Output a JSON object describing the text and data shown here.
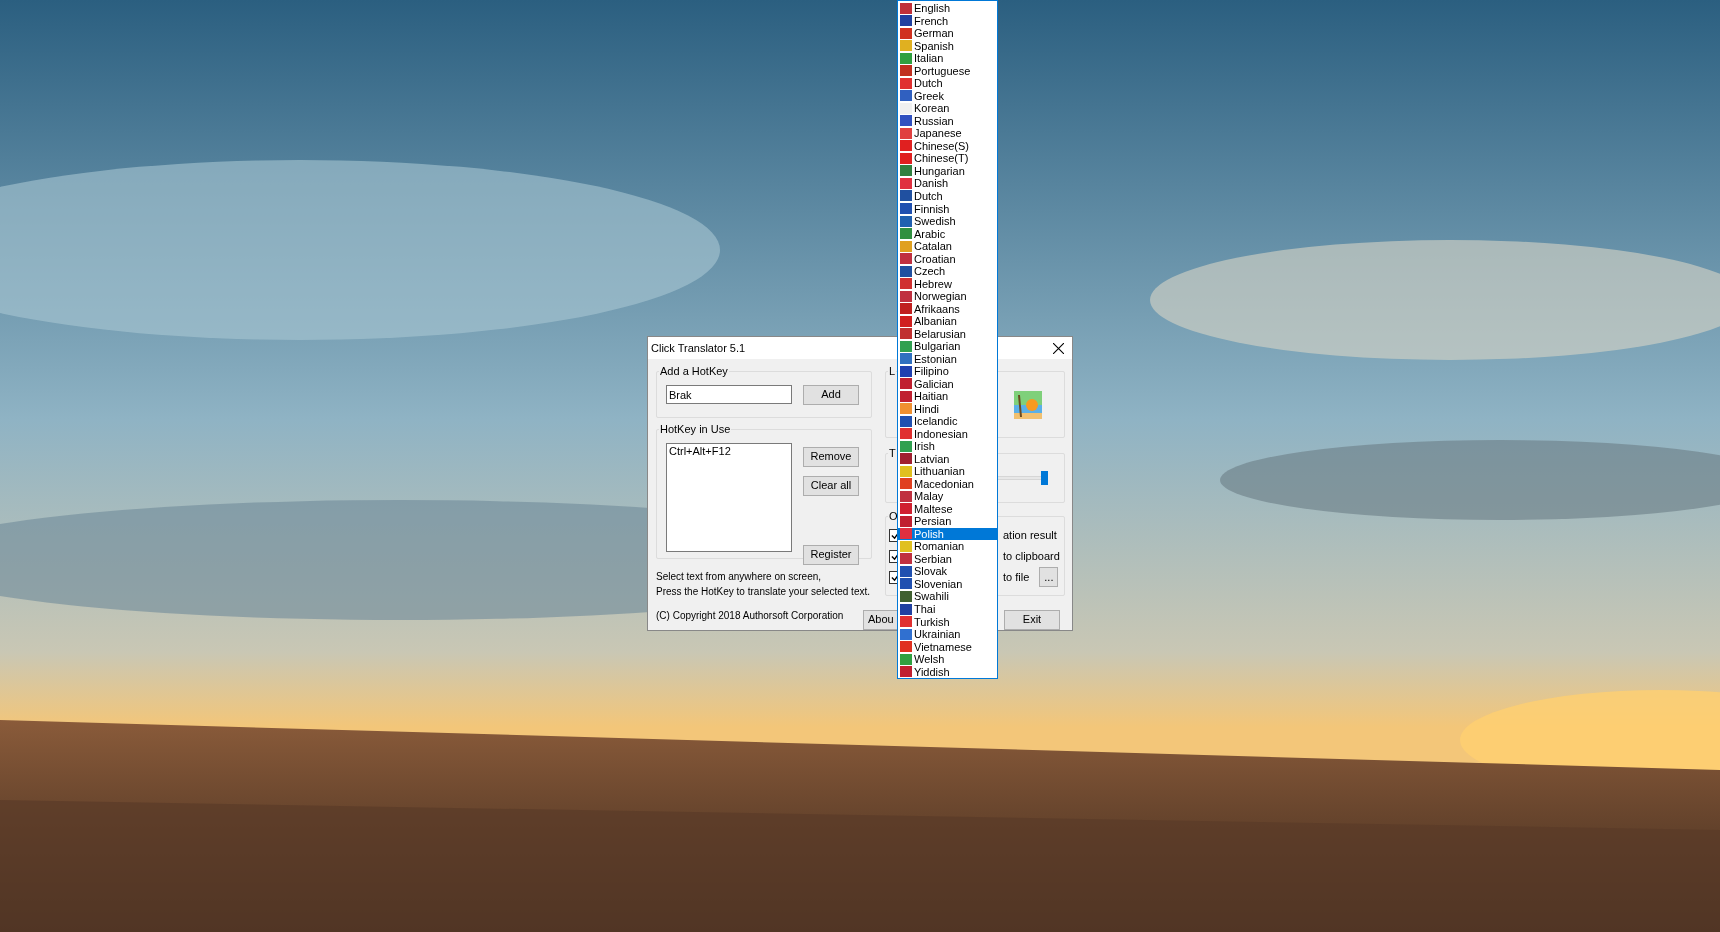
{
  "dialog": {
    "title": "Click Translator 5.1",
    "add_group": {
      "title": "Add a HotKey",
      "value": "Brak",
      "button": "Add"
    },
    "in_use_group": {
      "title": "HotKey in Use",
      "items": [
        "Ctrl+Alt+F12"
      ],
      "buttons": [
        "Remove",
        "Clear all",
        "Register"
      ]
    },
    "hint_lines": [
      "Select text from anywhere on screen,",
      "Press the HotKey to translate your selected text."
    ],
    "copyright": "(C) Copyright 2018 Authorsoft Corporation",
    "language_group": {
      "title": "L"
    },
    "slider_group": {
      "title": "T",
      "level": 1.0
    },
    "options_group": {
      "title": "O",
      "options": [
        {
          "label": "ation result",
          "checked": true
        },
        {
          "label": "to clipboard",
          "checked": true
        },
        {
          "label": "to file",
          "checked": true,
          "button": "..."
        }
      ]
    },
    "about_button": "Abou",
    "exit_button": "Exit"
  },
  "language_list": [
    {
      "label": "English",
      "color": "#c0303a",
      "selected": false
    },
    {
      "label": "French",
      "color": "#2040a0",
      "selected": false
    },
    {
      "label": "German",
      "color": "#d03020",
      "selected": false
    },
    {
      "label": "Spanish",
      "color": "#e0b020",
      "selected": false
    },
    {
      "label": "Italian",
      "color": "#30a040",
      "selected": false
    },
    {
      "label": "Portuguese",
      "color": "#c03020",
      "selected": false
    },
    {
      "label": "Dutch",
      "color": "#e03030",
      "selected": false
    },
    {
      "label": "Greek",
      "color": "#3060c0",
      "selected": false
    },
    {
      "label": "Korean",
      "color": "#f0f0f0",
      "selected": false
    },
    {
      "label": "Russian",
      "color": "#3050c0",
      "selected": false
    },
    {
      "label": "Japanese",
      "color": "#e04040",
      "selected": false
    },
    {
      "label": "Chinese(S)",
      "color": "#e02020",
      "selected": false
    },
    {
      "label": "Chinese(T)",
      "color": "#e02020",
      "selected": false
    },
    {
      "label": "Hungarian",
      "color": "#308040",
      "selected": false
    },
    {
      "label": "Danish",
      "color": "#e03040",
      "selected": false
    },
    {
      "label": "Dutch",
      "color": "#2050a0",
      "selected": false
    },
    {
      "label": "Finnish",
      "color": "#2050b0",
      "selected": false
    },
    {
      "label": "Swedish",
      "color": "#2060b0",
      "selected": false
    },
    {
      "label": "Arabic",
      "color": "#309040",
      "selected": false
    },
    {
      "label": "Catalan",
      "color": "#e0a020",
      "selected": false
    },
    {
      "label": "Croatian",
      "color": "#c03040",
      "selected": false
    },
    {
      "label": "Czech",
      "color": "#2050a0",
      "selected": false
    },
    {
      "label": "Hebrew",
      "color": "#d03030",
      "selected": false
    },
    {
      "label": "Norwegian",
      "color": "#c03040",
      "selected": false
    },
    {
      "label": "Afrikaans",
      "color": "#c02020",
      "selected": false
    },
    {
      "label": "Albanian",
      "color": "#d02020",
      "selected": false
    },
    {
      "label": "Belarusian",
      "color": "#c03030",
      "selected": false
    },
    {
      "label": "Bulgarian",
      "color": "#30a050",
      "selected": false
    },
    {
      "label": "Estonian",
      "color": "#3070c0",
      "selected": false
    },
    {
      "label": "Filipino",
      "color": "#2040b0",
      "selected": false
    },
    {
      "label": "Galician",
      "color": "#c02030",
      "selected": false
    },
    {
      "label": "Haitian",
      "color": "#c02030",
      "selected": false
    },
    {
      "label": "Hindi",
      "color": "#f09030",
      "selected": false
    },
    {
      "label": "Icelandic",
      "color": "#2050b0",
      "selected": false
    },
    {
      "label": "Indonesian",
      "color": "#e03030",
      "selected": false
    },
    {
      "label": "Irish",
      "color": "#30a050",
      "selected": false
    },
    {
      "label": "Latvian",
      "color": "#a02030",
      "selected": false
    },
    {
      "label": "Lithuanian",
      "color": "#e0c020",
      "selected": false
    },
    {
      "label": "Macedonian",
      "color": "#e04020",
      "selected": false
    },
    {
      "label": "Malay",
      "color": "#c03040",
      "selected": false
    },
    {
      "label": "Maltese",
      "color": "#d02030",
      "selected": false
    },
    {
      "label": "Persian",
      "color": "#c02030",
      "selected": false
    },
    {
      "label": "Polish",
      "color": "#e03040",
      "selected": true
    },
    {
      "label": "Romanian",
      "color": "#e0c020",
      "selected": false
    },
    {
      "label": "Serbian",
      "color": "#c03040",
      "selected": false
    },
    {
      "label": "Slovak",
      "color": "#2050b0",
      "selected": false
    },
    {
      "label": "Slovenian",
      "color": "#2050b0",
      "selected": false
    },
    {
      "label": "Swahili",
      "color": "#406030",
      "selected": false
    },
    {
      "label": "Thai",
      "color": "#2040a0",
      "selected": false
    },
    {
      "label": "Turkish",
      "color": "#e03030",
      "selected": false
    },
    {
      "label": "Ukrainian",
      "color": "#3070d0",
      "selected": false
    },
    {
      "label": "Vietnamese",
      "color": "#e03020",
      "selected": false
    },
    {
      "label": "Welsh",
      "color": "#30a040",
      "selected": false
    },
    {
      "label": "Yiddish",
      "color": "#c02030",
      "selected": false
    }
  ]
}
